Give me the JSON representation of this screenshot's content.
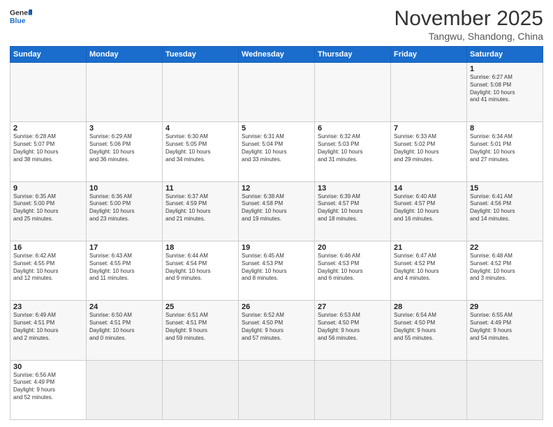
{
  "header": {
    "logo_general": "General",
    "logo_blue": "Blue",
    "month_title": "November 2025",
    "location": "Tangwu, Shandong, China"
  },
  "weekdays": [
    "Sunday",
    "Monday",
    "Tuesday",
    "Wednesday",
    "Thursday",
    "Friday",
    "Saturday"
  ],
  "weeks": [
    [
      {
        "day": "",
        "info": ""
      },
      {
        "day": "",
        "info": ""
      },
      {
        "day": "",
        "info": ""
      },
      {
        "day": "",
        "info": ""
      },
      {
        "day": "",
        "info": ""
      },
      {
        "day": "",
        "info": ""
      },
      {
        "day": "1",
        "info": "Sunrise: 6:27 AM\nSunset: 5:08 PM\nDaylight: 10 hours\nand 41 minutes."
      }
    ],
    [
      {
        "day": "2",
        "info": "Sunrise: 6:28 AM\nSunset: 5:07 PM\nDaylight: 10 hours\nand 38 minutes."
      },
      {
        "day": "3",
        "info": "Sunrise: 6:29 AM\nSunset: 5:06 PM\nDaylight: 10 hours\nand 36 minutes."
      },
      {
        "day": "4",
        "info": "Sunrise: 6:30 AM\nSunset: 5:05 PM\nDaylight: 10 hours\nand 34 minutes."
      },
      {
        "day": "5",
        "info": "Sunrise: 6:31 AM\nSunset: 5:04 PM\nDaylight: 10 hours\nand 33 minutes."
      },
      {
        "day": "6",
        "info": "Sunrise: 6:32 AM\nSunset: 5:03 PM\nDaylight: 10 hours\nand 31 minutes."
      },
      {
        "day": "7",
        "info": "Sunrise: 6:33 AM\nSunset: 5:02 PM\nDaylight: 10 hours\nand 29 minutes."
      },
      {
        "day": "8",
        "info": "Sunrise: 6:34 AM\nSunset: 5:01 PM\nDaylight: 10 hours\nand 27 minutes."
      }
    ],
    [
      {
        "day": "9",
        "info": "Sunrise: 6:35 AM\nSunset: 5:00 PM\nDaylight: 10 hours\nand 25 minutes."
      },
      {
        "day": "10",
        "info": "Sunrise: 6:36 AM\nSunset: 5:00 PM\nDaylight: 10 hours\nand 23 minutes."
      },
      {
        "day": "11",
        "info": "Sunrise: 6:37 AM\nSunset: 4:59 PM\nDaylight: 10 hours\nand 21 minutes."
      },
      {
        "day": "12",
        "info": "Sunrise: 6:38 AM\nSunset: 4:58 PM\nDaylight: 10 hours\nand 19 minutes."
      },
      {
        "day": "13",
        "info": "Sunrise: 6:39 AM\nSunset: 4:57 PM\nDaylight: 10 hours\nand 18 minutes."
      },
      {
        "day": "14",
        "info": "Sunrise: 6:40 AM\nSunset: 4:57 PM\nDaylight: 10 hours\nand 16 minutes."
      },
      {
        "day": "15",
        "info": "Sunrise: 6:41 AM\nSunset: 4:56 PM\nDaylight: 10 hours\nand 14 minutes."
      }
    ],
    [
      {
        "day": "16",
        "info": "Sunrise: 6:42 AM\nSunset: 4:55 PM\nDaylight: 10 hours\nand 12 minutes."
      },
      {
        "day": "17",
        "info": "Sunrise: 6:43 AM\nSunset: 4:55 PM\nDaylight: 10 hours\nand 11 minutes."
      },
      {
        "day": "18",
        "info": "Sunrise: 6:44 AM\nSunset: 4:54 PM\nDaylight: 10 hours\nand 9 minutes."
      },
      {
        "day": "19",
        "info": "Sunrise: 6:45 AM\nSunset: 4:53 PM\nDaylight: 10 hours\nand 8 minutes."
      },
      {
        "day": "20",
        "info": "Sunrise: 6:46 AM\nSunset: 4:53 PM\nDaylight: 10 hours\nand 6 minutes."
      },
      {
        "day": "21",
        "info": "Sunrise: 6:47 AM\nSunset: 4:52 PM\nDaylight: 10 hours\nand 4 minutes."
      },
      {
        "day": "22",
        "info": "Sunrise: 6:48 AM\nSunset: 4:52 PM\nDaylight: 10 hours\nand 3 minutes."
      }
    ],
    [
      {
        "day": "23",
        "info": "Sunrise: 6:49 AM\nSunset: 4:51 PM\nDaylight: 10 hours\nand 2 minutes."
      },
      {
        "day": "24",
        "info": "Sunrise: 6:50 AM\nSunset: 4:51 PM\nDaylight: 10 hours\nand 0 minutes."
      },
      {
        "day": "25",
        "info": "Sunrise: 6:51 AM\nSunset: 4:51 PM\nDaylight: 9 hours\nand 59 minutes."
      },
      {
        "day": "26",
        "info": "Sunrise: 6:52 AM\nSunset: 4:50 PM\nDaylight: 9 hours\nand 57 minutes."
      },
      {
        "day": "27",
        "info": "Sunrise: 6:53 AM\nSunset: 4:50 PM\nDaylight: 9 hours\nand 56 minutes."
      },
      {
        "day": "28",
        "info": "Sunrise: 6:54 AM\nSunset: 4:50 PM\nDaylight: 9 hours\nand 55 minutes."
      },
      {
        "day": "29",
        "info": "Sunrise: 6:55 AM\nSunset: 4:49 PM\nDaylight: 9 hours\nand 54 minutes."
      }
    ],
    [
      {
        "day": "30",
        "info": "Sunrise: 6:56 AM\nSunset: 4:49 PM\nDaylight: 9 hours\nand 52 minutes."
      },
      {
        "day": "",
        "info": ""
      },
      {
        "day": "",
        "info": ""
      },
      {
        "day": "",
        "info": ""
      },
      {
        "day": "",
        "info": ""
      },
      {
        "day": "",
        "info": ""
      },
      {
        "day": "",
        "info": ""
      }
    ]
  ]
}
